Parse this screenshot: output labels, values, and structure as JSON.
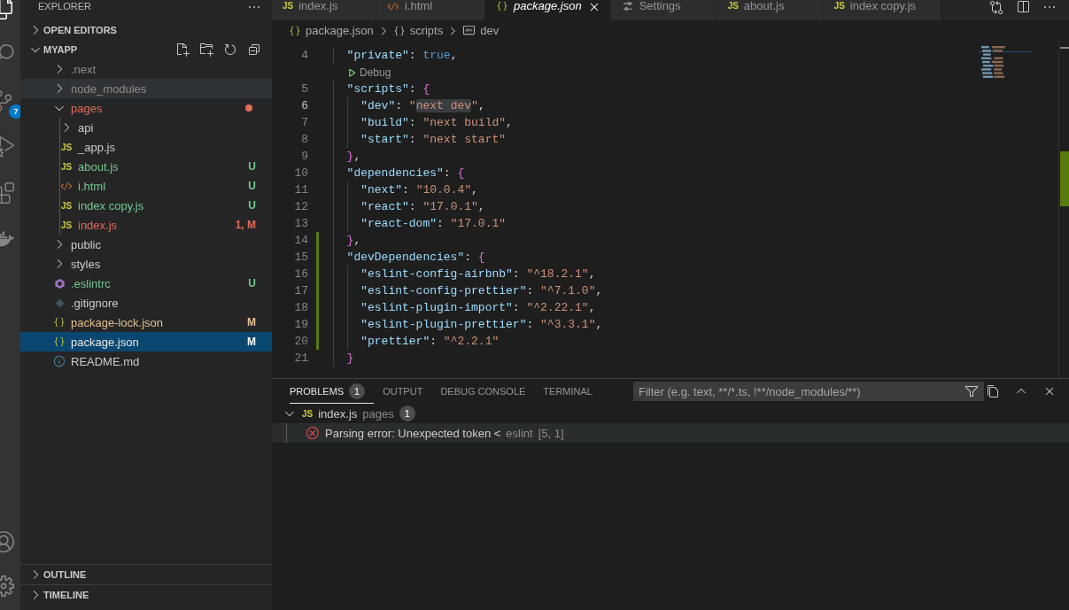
{
  "activity_bar": {
    "items": [
      {
        "kind": "files",
        "selected": true
      },
      {
        "kind": "search",
        "selected": false
      },
      {
        "kind": "source_control",
        "badge": "7",
        "selected": false
      },
      {
        "kind": "run",
        "selected": false
      },
      {
        "kind": "extensions",
        "selected": false
      },
      {
        "kind": "docker",
        "selected": false
      }
    ],
    "bottom_items": [
      {
        "kind": "account"
      },
      {
        "kind": "settings"
      }
    ]
  },
  "sidebar": {
    "title": "EXPLORER",
    "sections_top": [
      {
        "label": "OPEN EDITORS",
        "expanded": false
      }
    ],
    "root": {
      "label": "MYAPP",
      "expanded": true
    },
    "tree": [
      {
        "name": ".next",
        "kind": "folder",
        "expanded": false,
        "color": "#8c8c8c",
        "selected": false
      },
      {
        "name": "node_modules",
        "kind": "folder",
        "expanded": false,
        "color": "#8c8c8c",
        "selected": false,
        "hovered": true
      },
      {
        "name": "pages",
        "kind": "folder",
        "expanded": true,
        "color": "#e06c5c",
        "selected": false,
        "dot": true,
        "children": [
          {
            "name": "api",
            "kind": "folder",
            "expanded": false,
            "color": "#cccccc",
            "selected": false
          },
          {
            "name": "_app.js",
            "kind": "js",
            "icon": "JS",
            "color": "#cccccc",
            "selected": false
          },
          {
            "name": "about.js",
            "kind": "js",
            "icon": "JS",
            "color": "#73c991",
            "badge": "U",
            "selected": false
          },
          {
            "name": "i.html",
            "kind": "html",
            "color": "#73c991",
            "badge": "U",
            "selected": false
          },
          {
            "name": "index copy.js",
            "kind": "js",
            "icon": "JS",
            "color": "#73c991",
            "badge": "U",
            "selected": false
          },
          {
            "name": "index.js",
            "kind": "js",
            "icon": "JS",
            "color": "#e06c5c",
            "badge": "1, M",
            "selected": false
          }
        ]
      },
      {
        "name": "public",
        "kind": "folder",
        "expanded": false,
        "color": "#cccccc",
        "selected": false
      },
      {
        "name": "styles",
        "kind": "folder",
        "expanded": false,
        "color": "#cccccc",
        "selected": false
      },
      {
        "name": ".eslintrc",
        "kind": "eslint",
        "color": "#73c991",
        "badge": "U",
        "selected": false
      },
      {
        "name": ".gitignore",
        "kind": "git",
        "color": "#cccccc",
        "selected": false
      },
      {
        "name": "package-lock.json",
        "kind": "json",
        "color": "#e2c08d",
        "badge": "M",
        "selected": false
      },
      {
        "name": "package.json",
        "kind": "json",
        "color": "#e8e8e8",
        "badge": "M",
        "selected": true
      },
      {
        "name": "README.md",
        "kind": "info",
        "color": "#cccccc",
        "selected": false
      }
    ],
    "sections_bottom": [
      {
        "label": "OUTLINE",
        "expanded": false
      },
      {
        "label": "TIMELINE",
        "expanded": false
      }
    ]
  },
  "tabs": [
    {
      "label": "index.js",
      "kind": "js",
      "icon": "JS",
      "selected": false,
      "preview": false
    },
    {
      "label": "i.html",
      "kind": "html",
      "selected": false,
      "preview": false
    },
    {
      "label": "package.json",
      "kind": "json",
      "selected": true,
      "preview": true
    },
    {
      "label": "Settings",
      "kind": "settings",
      "selected": false,
      "preview": false
    },
    {
      "label": "about.js",
      "kind": "js",
      "icon": "JS",
      "selected": false,
      "preview": false
    },
    {
      "label": "index copy.js",
      "kind": "js",
      "icon": "JS",
      "selected": false,
      "preview": false
    }
  ],
  "breadcrumbs": [
    {
      "kind": "json",
      "label": "package.json"
    },
    {
      "kind": "object",
      "label": "scripts"
    },
    {
      "kind": "string",
      "label": "dev"
    }
  ],
  "code": [
    {
      "kind": "code",
      "number": "4",
      "tokens": [
        {
          "kind": "key",
          "s": "  \"private\""
        },
        {
          "kind": "punct",
          "s": ": "
        },
        {
          "kind": "bool",
          "s": "true"
        },
        {
          "kind": "punct",
          "s": ","
        }
      ]
    },
    {
      "kind": "codelens",
      "text": "Debug"
    },
    {
      "kind": "code",
      "number": "5",
      "tokens": [
        {
          "kind": "key",
          "s": "  \"scripts\""
        },
        {
          "kind": "punct",
          "s": ": "
        },
        {
          "kind": "bracket",
          "s": "{"
        }
      ]
    },
    {
      "kind": "code",
      "number": "6",
      "current": true,
      "tokens": [
        {
          "kind": "key",
          "s": "    \"dev\""
        },
        {
          "kind": "punct",
          "s": ": "
        },
        {
          "kind": "string",
          "s": "\""
        },
        {
          "kind": "string",
          "s": "next dev",
          "highlight": true
        },
        {
          "kind": "string",
          "s": "\""
        },
        {
          "kind": "punct",
          "s": ","
        }
      ]
    },
    {
      "kind": "code",
      "number": "7",
      "tokens": [
        {
          "kind": "key",
          "s": "    \"build\""
        },
        {
          "kind": "punct",
          "s": ": "
        },
        {
          "kind": "string",
          "s": "\"next build\""
        },
        {
          "kind": "punct",
          "s": ","
        }
      ]
    },
    {
      "kind": "code",
      "number": "8",
      "tokens": [
        {
          "kind": "key",
          "s": "    \"start\""
        },
        {
          "kind": "punct",
          "s": ": "
        },
        {
          "kind": "string",
          "s": "\"next start\""
        }
      ]
    },
    {
      "kind": "code",
      "number": "9",
      "tokens": [
        {
          "kind": "bracket",
          "s": "  }"
        },
        {
          "kind": "punct",
          "s": ","
        }
      ]
    },
    {
      "kind": "code",
      "number": "10",
      "tokens": [
        {
          "kind": "key",
          "s": "  \"dependencies\""
        },
        {
          "kind": "punct",
          "s": ": "
        },
        {
          "kind": "bracket",
          "s": "{"
        }
      ]
    },
    {
      "kind": "code",
      "number": "11",
      "tokens": [
        {
          "kind": "key",
          "s": "    \"next\""
        },
        {
          "kind": "punct",
          "s": ": "
        },
        {
          "kind": "string",
          "s": "\"10.0.4\""
        },
        {
          "kind": "punct",
          "s": ","
        }
      ]
    },
    {
      "kind": "code",
      "number": "12",
      "tokens": [
        {
          "kind": "key",
          "s": "    \"react\""
        },
        {
          "kind": "punct",
          "s": ": "
        },
        {
          "kind": "string",
          "s": "\"17.0.1\""
        },
        {
          "kind": "punct",
          "s": ","
        }
      ]
    },
    {
      "kind": "code",
      "number": "13",
      "tokens": [
        {
          "kind": "key",
          "s": "    \"react-dom\""
        },
        {
          "kind": "punct",
          "s": ": "
        },
        {
          "kind": "string",
          "s": "\"17.0.1\""
        }
      ]
    },
    {
      "kind": "code",
      "number": "14",
      "modified": true,
      "tokens": [
        {
          "kind": "bracket",
          "s": "  }"
        },
        {
          "kind": "punct",
          "s": ","
        }
      ]
    },
    {
      "kind": "code",
      "number": "15",
      "modified": true,
      "tokens": [
        {
          "kind": "key",
          "s": "  \"devDependencies\""
        },
        {
          "kind": "punct",
          "s": ": "
        },
        {
          "kind": "bracket",
          "s": "{"
        }
      ]
    },
    {
      "kind": "code",
      "number": "16",
      "modified": true,
      "tokens": [
        {
          "kind": "key",
          "s": "    \"eslint-config-airbnb\""
        },
        {
          "kind": "punct",
          "s": ": "
        },
        {
          "kind": "string",
          "s": "\"^18.2.1\""
        },
        {
          "kind": "punct",
          "s": ","
        }
      ]
    },
    {
      "kind": "code",
      "number": "17",
      "modified": true,
      "tokens": [
        {
          "kind": "key",
          "s": "    \"eslint-config-prettier\""
        },
        {
          "kind": "punct",
          "s": ": "
        },
        {
          "kind": "string",
          "s": "\"^7.1.0\""
        },
        {
          "kind": "punct",
          "s": ","
        }
      ]
    },
    {
      "kind": "code",
      "number": "18",
      "modified": true,
      "tokens": [
        {
          "kind": "key",
          "s": "    \"eslint-plugin-import\""
        },
        {
          "kind": "punct",
          "s": ": "
        },
        {
          "kind": "string",
          "s": "\"^2.22.1\""
        },
        {
          "kind": "punct",
          "s": ","
        }
      ]
    },
    {
      "kind": "code",
      "number": "19",
      "modified": true,
      "tokens": [
        {
          "kind": "key",
          "s": "    \"eslint-plugin-prettier\""
        },
        {
          "kind": "punct",
          "s": ": "
        },
        {
          "kind": "string",
          "s": "\"^3.3.1\""
        },
        {
          "kind": "punct",
          "s": ","
        }
      ]
    },
    {
      "kind": "code",
      "number": "20",
      "modified": true,
      "tokens": [
        {
          "kind": "key",
          "s": "    \"prettier\""
        },
        {
          "kind": "punct",
          "s": ": "
        },
        {
          "kind": "string",
          "s": "\"^2.2.1\""
        }
      ]
    },
    {
      "kind": "code",
      "number": "21",
      "tokens": [
        {
          "kind": "bracket",
          "s": "  }"
        }
      ]
    }
  ],
  "panel": {
    "tabs": [
      {
        "label": "PROBLEMS",
        "count": "1",
        "selected": true
      },
      {
        "label": "OUTPUT",
        "selected": false
      },
      {
        "label": "DEBUG CONSOLE",
        "selected": false
      },
      {
        "label": "TERMINAL",
        "selected": false
      }
    ],
    "filter": {
      "placeholder": "Filter (e.g. text, **/*.ts, !**/node_modules/**)"
    },
    "problems": [
      {
        "file": "index.js",
        "icon": "JS",
        "folder": "pages",
        "count": "1",
        "expanded": true,
        "children": [
          {
            "message": "Parsing error: Unexpected token <",
            "source": "eslint",
            "position": "[5, 1]",
            "selected": true
          }
        ]
      }
    ]
  }
}
